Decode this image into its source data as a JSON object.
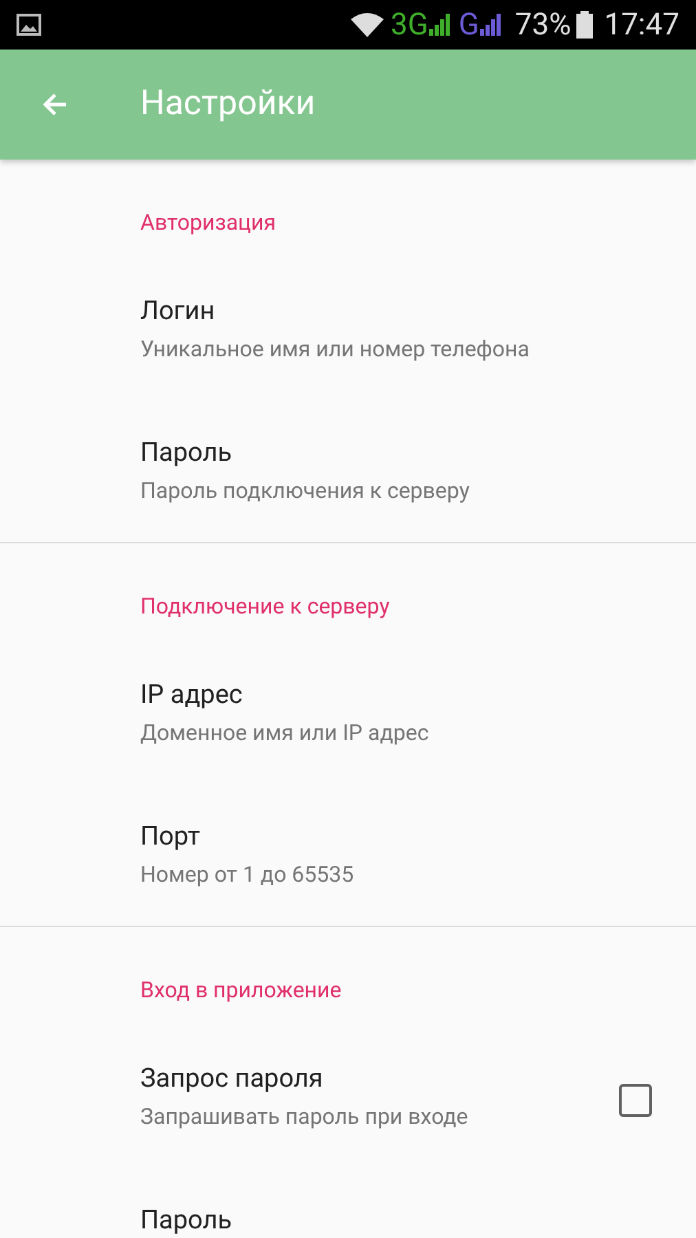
{
  "status_bar": {
    "network_1": "3G",
    "network_2": "G",
    "battery": "73%",
    "time": "17:47"
  },
  "app_bar": {
    "title": "Настройки"
  },
  "sections": [
    {
      "header": "Авторизация",
      "items": [
        {
          "kind": "text",
          "title": "Логин",
          "subtitle": "Уникальное имя или номер телефона"
        },
        {
          "kind": "text",
          "title": "Пароль",
          "subtitle": "Пароль подключения к серверу"
        }
      ]
    },
    {
      "header": "Подключение к серверу",
      "items": [
        {
          "kind": "text",
          "title": "IP адрес",
          "subtitle": "Доменное имя или IP адрес"
        },
        {
          "kind": "text",
          "title": "Порт",
          "subtitle": "Номер от 1 до 65535"
        }
      ]
    },
    {
      "header": "Вход в приложение",
      "items": [
        {
          "kind": "checkbox",
          "title": "Запрос пароля",
          "subtitle": "Запрашивать пароль при входе",
          "checked": false
        },
        {
          "kind": "text",
          "title": "Пароль"
        }
      ]
    }
  ]
}
